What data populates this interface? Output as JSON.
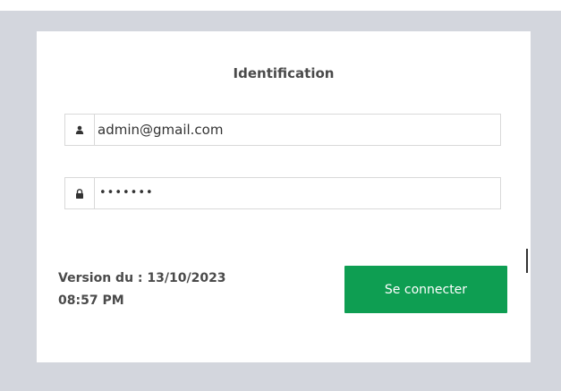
{
  "login": {
    "title": "Identification",
    "email_value": "admin@gmail.com",
    "password_mask": "•••••••",
    "version_line1": "Version du : 13/10/2023",
    "version_line2": "08:57 PM",
    "submit_label": "Se connecter"
  },
  "icons": {
    "user": "user-icon",
    "lock": "lock-icon"
  },
  "colors": {
    "backdrop": "#d3d6dd",
    "button": "#0e9e52",
    "text": "#4a4a4a"
  }
}
